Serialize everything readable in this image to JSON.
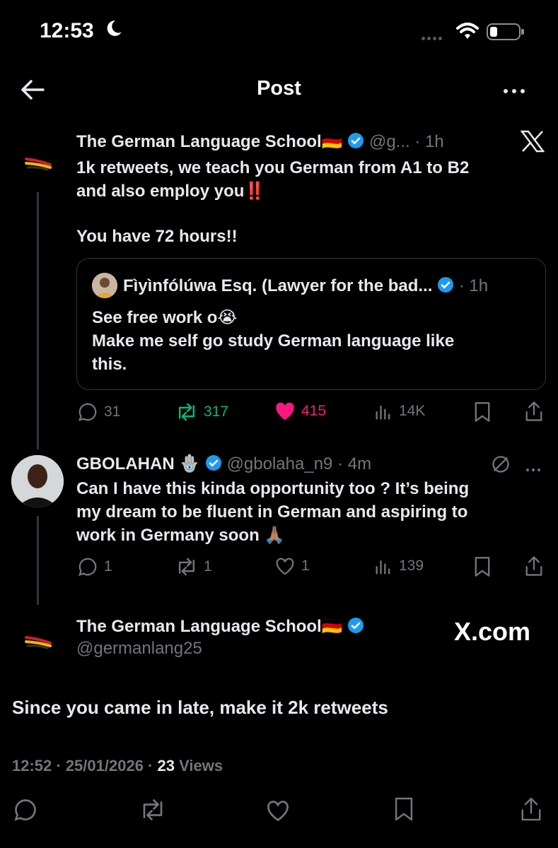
{
  "status_bar": {
    "time": "12:53"
  },
  "header": {
    "title": "Post"
  },
  "main_tweet": {
    "name": "The German Language School🇩🇪",
    "handle": "@g...",
    "time": "· 1h",
    "text_line1": "1k retweets, we teach you German from A1 to B2",
    "text_line2": "and also employ you‼️",
    "text_line3": "You have 72 hours!!",
    "quote": {
      "name": "Fìyìnfólúwa Esq. (Lawyer for the bad...",
      "time": "· 1h",
      "line1": "See free work o😭",
      "line2": "Make me self go study German language like",
      "line3": "this."
    },
    "stats": {
      "replies": "31",
      "retweets": "317",
      "likes": "415",
      "views": "14K"
    }
  },
  "reply": {
    "name": "GBOLAHAN 🪬",
    "handle": "@gbolaha_n9",
    "time": "· 4m",
    "line1": "Can I have this kinda opportunity too ? It’s being",
    "line2": "my dream to be fluent in German and aspiring to",
    "line3": "work in Germany soon 🙏🏽",
    "stats": {
      "replies": "1",
      "retweets": "1",
      "likes": "1",
      "views": "139"
    }
  },
  "focused_post": {
    "name": "The German Language School🇩🇪",
    "handle": "@germanlang25",
    "text": "Since you came in late, make it 2k retweets",
    "timestamp": "12:52 · 25/01/2026 ·",
    "views_count": "23",
    "views_label": "Views"
  },
  "watermark": "X.com",
  "colors": {
    "verified": "#1d9bf0",
    "retweet": "#00ba7c",
    "like": "#f91880",
    "muted": "#71767b"
  }
}
